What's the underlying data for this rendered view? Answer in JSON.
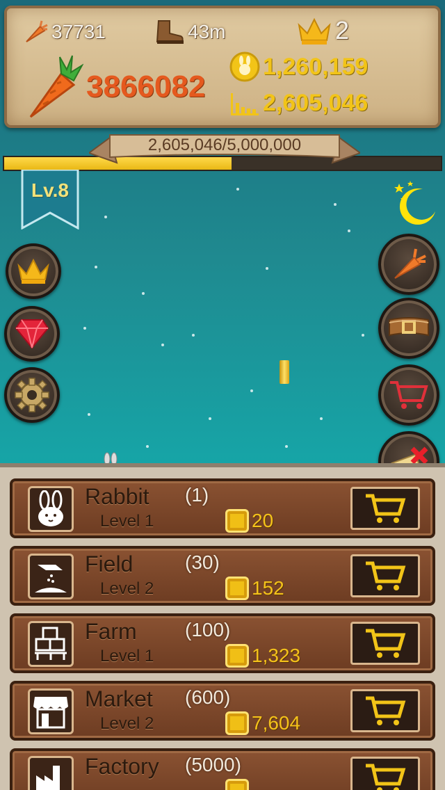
{
  "stats": {
    "carrot_rate": "37731",
    "distance": "43m",
    "crowns": "2",
    "carrots": "3866082",
    "coins": "1,260,159",
    "stat_total": "2,605,046"
  },
  "progress": {
    "label": "2,605,046/5,000,000",
    "fraction": 0.521
  },
  "level": "Lv.8",
  "left_buttons": [
    "crown-icon",
    "ruby-icon",
    "gear-icon"
  ],
  "right_buttons": [
    "carrot-icon",
    "belt-icon",
    "cart-icon",
    "scroll-icon"
  ],
  "shop": {
    "items": [
      {
        "name": "Rabbit",
        "level": "Level 1",
        "count": "(1)",
        "price": "20",
        "icon": "rabbit-icon"
      },
      {
        "name": "Field",
        "level": "Level 2",
        "count": "(30)",
        "price": "152",
        "icon": "field-icon"
      },
      {
        "name": "Farm",
        "level": "Level 1",
        "count": "(100)",
        "price": "1,323",
        "icon": "farm-icon"
      },
      {
        "name": "Market",
        "level": "Level 2",
        "count": "(600)",
        "price": "7,604",
        "icon": "market-icon"
      },
      {
        "name": "Factory",
        "level": "",
        "count": "(5000)",
        "price": "",
        "icon": "factory-icon"
      }
    ]
  },
  "colors": {
    "sky": "#1f8a90",
    "wood": "#7a4528",
    "gold": "#f2c418",
    "carrot": "#e5591e"
  }
}
